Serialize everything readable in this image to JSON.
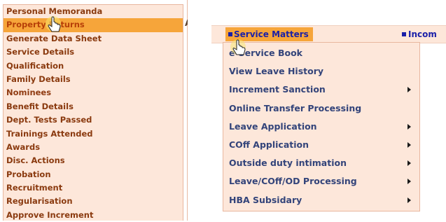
{
  "left_menu": {
    "items": [
      {
        "label": "Personal Memoranda",
        "state": "normal"
      },
      {
        "label": "Property Returns",
        "state": "active"
      },
      {
        "label": "Generate Data Sheet",
        "state": "normal"
      },
      {
        "label": "Service Details",
        "state": "normal"
      },
      {
        "label": "Qualification",
        "state": "normal"
      },
      {
        "label": "Family Details",
        "state": "normal"
      },
      {
        "label": "Nominees",
        "state": "normal"
      },
      {
        "label": "Benefit Details",
        "state": "normal"
      },
      {
        "label": "Dept. Tests Passed",
        "state": "normal"
      },
      {
        "label": "Trainings Attended",
        "state": "normal"
      },
      {
        "label": "Awards",
        "state": "normal"
      },
      {
        "label": "Disc. Actions",
        "state": "normal"
      },
      {
        "label": "Probation",
        "state": "normal"
      },
      {
        "label": "Recruitment",
        "state": "normal"
      },
      {
        "label": "Regularisation",
        "state": "normal"
      },
      {
        "label": "Approve Increment",
        "state": "normal"
      }
    ],
    "partial_heading": "Ac"
  },
  "right_panel": {
    "menubar": {
      "active_menu": "Service Matters",
      "next_menu": "Incom"
    },
    "dropdown": {
      "items": [
        {
          "label": "e-Service Book",
          "has_submenu": false
        },
        {
          "label": "View Leave History",
          "has_submenu": false
        },
        {
          "label": "Increment Sanction",
          "has_submenu": true
        },
        {
          "label": "Online Transfer Processing",
          "has_submenu": false
        },
        {
          "label": "Leave Application",
          "has_submenu": true
        },
        {
          "label": "COff Application",
          "has_submenu": true
        },
        {
          "label": "Outside duty intimation",
          "has_submenu": true
        },
        {
          "label": "Leave/COff/OD Processing",
          "has_submenu": true
        },
        {
          "label": "HBA Subsidary",
          "has_submenu": true
        }
      ]
    }
  },
  "colors": {
    "menu_bg": "#fde7da",
    "active_bg": "#f6a53a",
    "left_text": "#8a3a0f",
    "dropdown_text": "#33447a",
    "menubar_text": "#1a1fa8"
  },
  "icons": {
    "cursor": "hand-pointer-icon",
    "submenu": "submenu-arrow-icon",
    "menu_bullet": "square-bullet-icon"
  }
}
